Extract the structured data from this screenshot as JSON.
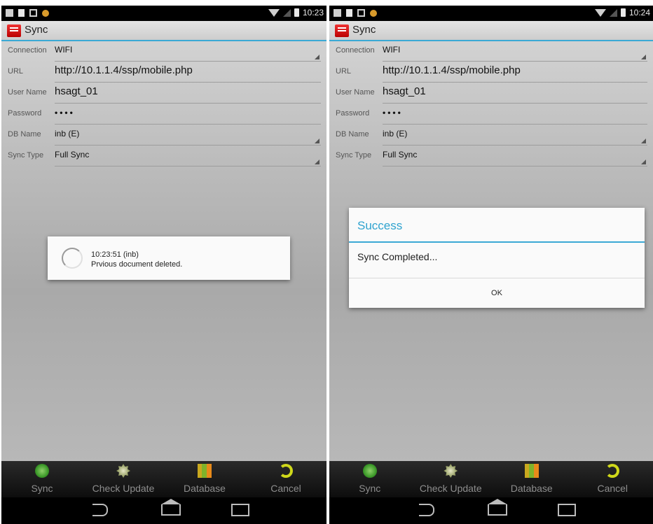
{
  "screens": [
    {
      "status_time": "10:23",
      "app_title": "Sync",
      "form": [
        {
          "label": "Connection",
          "value": "WIFI"
        },
        {
          "label": "URL",
          "value": "http://10.1.1.4/ssp/mobile.php"
        },
        {
          "label": "User Name",
          "value": "hsagt_01"
        },
        {
          "label": "Password",
          "value": "••••"
        },
        {
          "label": "DB Name",
          "value": "inb (E)"
        },
        {
          "label": "Sync Type",
          "value": "Full Sync"
        }
      ],
      "progress_dialog": {
        "time": "10:23:51 (inb)",
        "message": "Prvious document deleted."
      },
      "toolbar": [
        {
          "label": "Sync",
          "icon": "sync-icon"
        },
        {
          "label": "Check Update",
          "icon": "gear-icon"
        },
        {
          "label": "Database",
          "icon": "database-icon"
        },
        {
          "label": "Cancel",
          "icon": "cancel-icon"
        }
      ]
    },
    {
      "status_time": "10:24",
      "app_title": "Sync",
      "form": [
        {
          "label": "Connection",
          "value": "WIFI"
        },
        {
          "label": "URL",
          "value": "http://10.1.1.4/ssp/mobile.php"
        },
        {
          "label": "User Name",
          "value": "hsagt_01"
        },
        {
          "label": "Password",
          "value": "••••"
        },
        {
          "label": "DB Name",
          "value": "inb (E)"
        },
        {
          "label": "Sync Type",
          "value": "Full Sync"
        }
      ],
      "alert_dialog": {
        "title": "Success",
        "message": "Sync Completed...",
        "button": "OK"
      },
      "toolbar": [
        {
          "label": "Sync",
          "icon": "sync-icon"
        },
        {
          "label": "Check Update",
          "icon": "gear-icon"
        },
        {
          "label": "Database",
          "icon": "database-icon"
        },
        {
          "label": "Cancel",
          "icon": "cancel-icon"
        }
      ]
    }
  ],
  "colors": {
    "accent": "#3ba9d5",
    "dialog_title": "#2fa3cf"
  }
}
